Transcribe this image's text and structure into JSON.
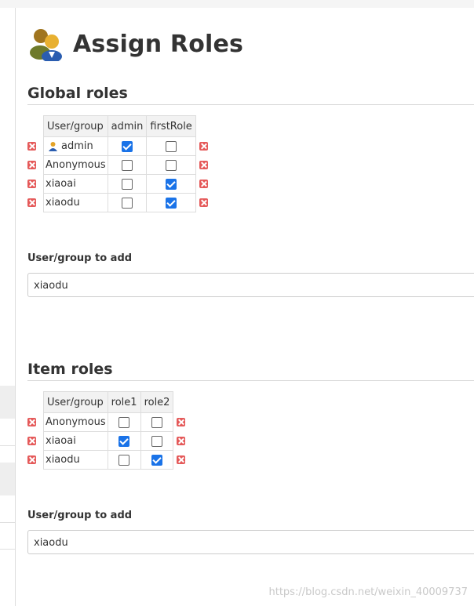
{
  "page": {
    "title": "Assign Roles"
  },
  "global_roles": {
    "header": "Global roles",
    "columns": [
      "User/group",
      "admin",
      "firstRole"
    ],
    "rows": [
      {
        "name": "admin",
        "has_user_icon": true,
        "checks": [
          true,
          false
        ]
      },
      {
        "name": "Anonymous",
        "has_user_icon": false,
        "checks": [
          false,
          false
        ]
      },
      {
        "name": "xiaoai",
        "has_user_icon": false,
        "checks": [
          false,
          true
        ]
      },
      {
        "name": "xiaodu",
        "has_user_icon": false,
        "checks": [
          false,
          true
        ]
      }
    ],
    "add_label": "User/group to add",
    "add_value": "xiaodu"
  },
  "item_roles": {
    "header": "Item roles",
    "columns": [
      "User/group",
      "role1",
      "role2"
    ],
    "rows": [
      {
        "name": "Anonymous",
        "checks": [
          false,
          false
        ]
      },
      {
        "name": "xiaoai",
        "checks": [
          true,
          false
        ]
      },
      {
        "name": "xiaodu",
        "checks": [
          false,
          true
        ]
      }
    ],
    "add_label": "User/group to add",
    "add_value": "xiaodu"
  },
  "watermark": "https://blog.csdn.net/weixin_40009737",
  "colors": {
    "checkbox_on": "#1a73e8",
    "delete_icon": "#e55a5a",
    "table_header_bg": "#f2f2f2"
  }
}
